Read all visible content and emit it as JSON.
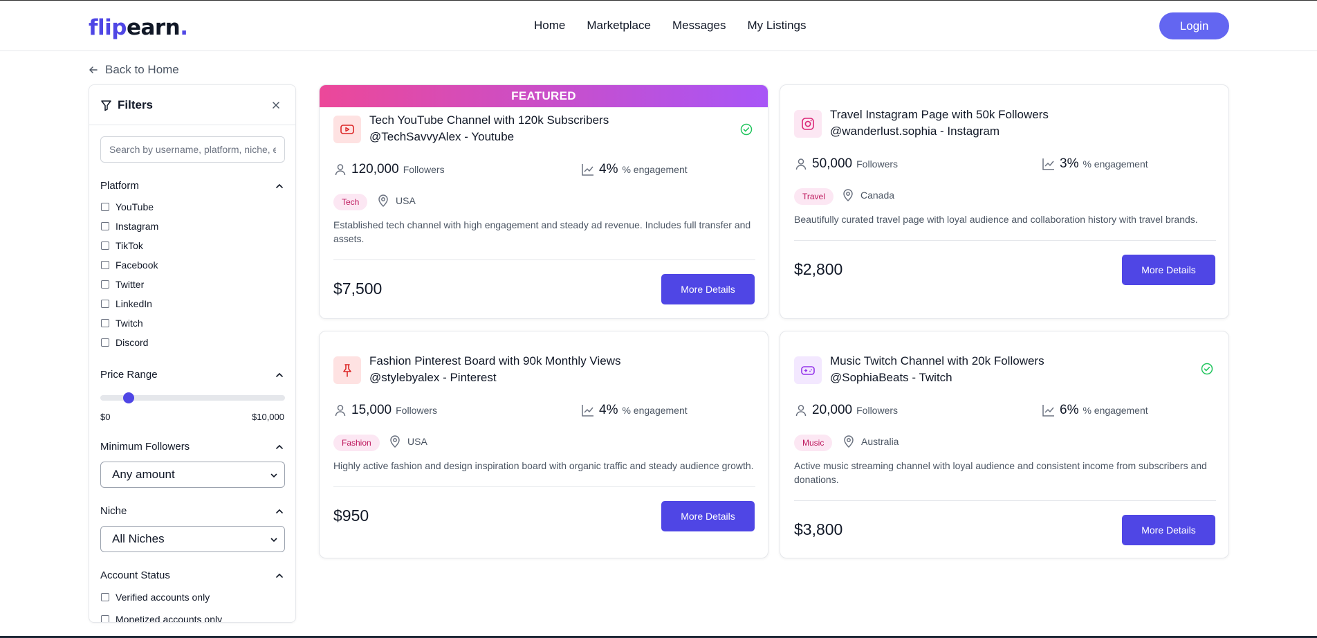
{
  "header": {
    "logo": {
      "part1": "flip",
      "part2": "earn",
      "part3": "."
    },
    "nav": [
      "Home",
      "Marketplace",
      "Messages",
      "My Listings"
    ],
    "login": "Login"
  },
  "back_label": "Back to Home",
  "filters": {
    "title": "Filters",
    "search_placeholder": "Search by username, platform, niche, etc.",
    "platform_title": "Platform",
    "platforms": [
      "YouTube",
      "Instagram",
      "TikTok",
      "Facebook",
      "Twitter",
      "LinkedIn",
      "Twitch",
      "Discord"
    ],
    "price_title": "Price Range",
    "price_min": "$0",
    "price_max": "$10,000",
    "price_slider_value": 0.13,
    "followers_title": "Minimum Followers",
    "followers_value": "Any amount",
    "niche_title": "Niche",
    "niche_value": "All Niches",
    "status_title": "Account Status",
    "status_options": [
      "Verified accounts only",
      "Monetized accounts only"
    ]
  },
  "listings": [
    {
      "featured": "FEATURED",
      "title": "Tech YouTube Channel with 120k Subscribers",
      "handle": "@TechSavvyAlex - Youtube",
      "icon": "youtube-icon",
      "verified": true,
      "followers": "120,000",
      "followers_label": "Followers",
      "engagement": "4%",
      "engagement_label": "% engagement",
      "tag": "Tech",
      "location": "USA",
      "description": "Established tech channel with high engagement and steady ad revenue. Includes full transfer and assets.",
      "price": "$7,500",
      "button": "More Details"
    },
    {
      "featured": "",
      "title": "Travel Instagram Page with 50k Followers",
      "handle": "@wanderlust.sophia - Instagram",
      "icon": "instagram-icon",
      "verified": false,
      "followers": "50,000",
      "followers_label": "Followers",
      "engagement": "3%",
      "engagement_label": "% engagement",
      "tag": "Travel",
      "location": "Canada",
      "description": "Beautifully curated travel page with loyal audience and collaboration history with travel brands.",
      "price": "$2,800",
      "button": "More Details"
    },
    {
      "featured": "",
      "title": "Fashion Pinterest Board with 90k Monthly Views",
      "handle": "@stylebyalex - Pinterest",
      "icon": "pin-icon",
      "verified": false,
      "followers": "15,000",
      "followers_label": "Followers",
      "engagement": "4%",
      "engagement_label": "% engagement",
      "tag": "Fashion",
      "location": "USA",
      "description": "Highly active fashion and design inspiration board with organic traffic and steady audience growth.",
      "price": "$950",
      "button": "More Details"
    },
    {
      "featured": "",
      "title": "Music Twitch Channel with 20k Followers",
      "handle": "@SophiaBeats - Twitch",
      "icon": "gamepad-icon",
      "verified": true,
      "followers": "20,000",
      "followers_label": "Followers",
      "engagement": "6%",
      "engagement_label": "% engagement",
      "tag": "Music",
      "location": "Australia",
      "description": "Active music streaming channel with loyal audience and consistent income from subscribers and donations.",
      "price": "$3,800",
      "button": "More Details"
    }
  ],
  "colors": {
    "primary": "#4f46e5",
    "login": "#6366f1",
    "tag_bg": "#fce7f3",
    "tag_text": "#be185d",
    "verified": "#22c55e"
  }
}
